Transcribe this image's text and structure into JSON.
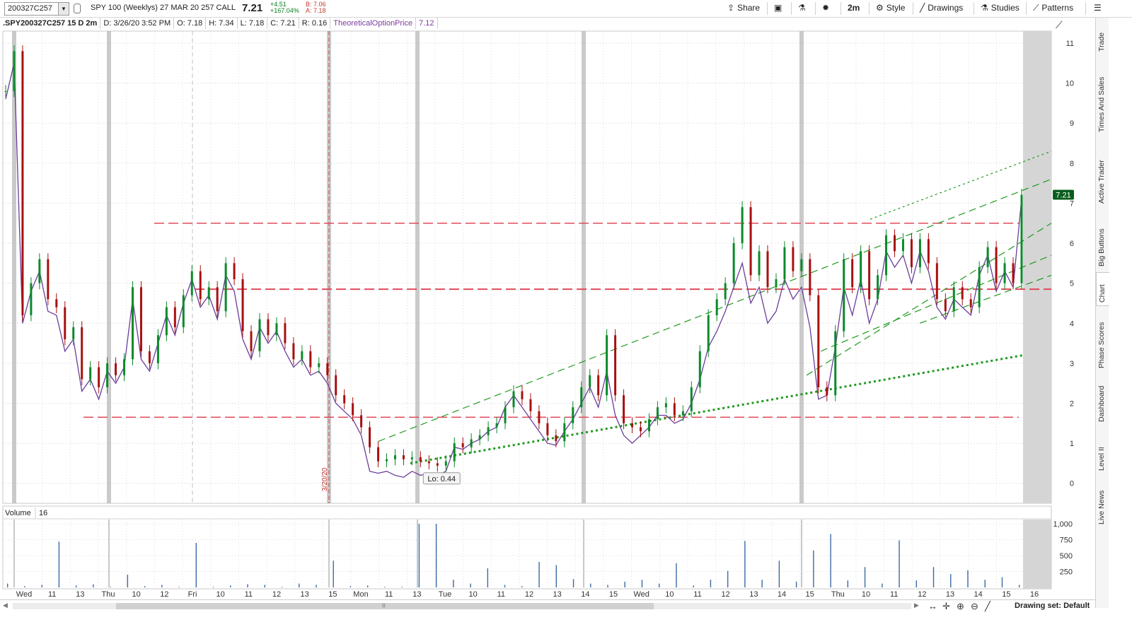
{
  "toolbar": {
    "symbol": "200327C257",
    "description": "SPY 100 (Weeklys) 27 MAR 20 257 CALL",
    "last": "7.21",
    "change": "+4.51",
    "change_pct": "+167.04%",
    "bid": "B: 7.06",
    "ask": "A: 7.18",
    "share": "Share",
    "interval": "2m",
    "style": "Style",
    "drawings": "Drawings",
    "studies": "Studies",
    "patterns": "Patterns"
  },
  "info": {
    "symbol": ".SPY200327C257 15 D 2m",
    "date": "D: 3/26/20 3:52 PM",
    "open": "O: 7.18",
    "high": "H: 7.34",
    "low": "L: 7.18",
    "close": "C: 7.21",
    "range": "R: 0.16",
    "study": "TheoreticalOptionPrice",
    "study_value": "7.12"
  },
  "price_badge": "7.21",
  "low_marker": "Lo: 0.44",
  "date_marker": "3/20/20",
  "volume_label": "Volume",
  "volume_value": "16",
  "right_nav": [
    "Trade",
    "Times And Sales",
    "Active Trader",
    "Big Buttons",
    "Chart",
    "Phase Scores",
    "Dashboard",
    "Level II",
    "Live News"
  ],
  "active_tab": "Chart",
  "drawing_set": "Drawing set: Default",
  "colors": {
    "up": "#0a8a2a",
    "down": "#a81010",
    "study": "#6a3d9a",
    "trend": "#1e9a1e",
    "hline": "#e04a5a"
  },
  "chart_data": {
    "type": "candlestick",
    "y_ticks": [
      "0",
      "1",
      "2",
      "3",
      "4",
      "5",
      "6",
      "7",
      "8",
      "9",
      "10",
      "11"
    ],
    "ylim": [
      -0.5,
      11.3
    ],
    "volume_ticks": [
      "250",
      "500",
      "750",
      "1,000"
    ],
    "volume_ylim": [
      0,
      1000
    ],
    "x_labels": [
      "Wed",
      "11",
      "13",
      "Thu",
      "10",
      "12",
      "Fri",
      "10",
      "11",
      "12",
      "13",
      "15",
      "Mon",
      "11",
      "13",
      "Tue",
      "10",
      "11",
      "12",
      "13",
      "14",
      "15",
      "Wed",
      "10",
      "11",
      "12",
      "13",
      "14",
      "15",
      "Thu",
      "10",
      "11",
      "12",
      "13",
      "14",
      "15",
      "16"
    ],
    "session_dividers": [
      3.0,
      5.0
    ],
    "horizontal_levels": [
      6.5,
      4.85,
      1.65
    ],
    "closes": [
      9.8,
      10.8,
      4.2,
      5.0,
      5.6,
      4.6,
      4.4,
      3.6,
      3.9,
      2.6,
      2.9,
      2.4,
      3.0,
      2.7,
      3.1,
      4.9,
      3.3,
      3.0,
      3.7,
      4.4,
      3.9,
      4.7,
      5.3,
      4.6,
      4.9,
      4.3,
      5.5,
      5.1,
      3.8,
      3.3,
      4.1,
      3.7,
      4.0,
      3.5,
      3.1,
      3.3,
      2.9,
      3.0,
      2.7,
      2.2,
      2.0,
      1.7,
      1.4,
      0.9,
      0.55,
      0.6,
      0.7,
      0.6,
      0.65,
      0.55,
      0.5,
      0.44,
      0.55,
      1.0,
      0.9,
      1.1,
      1.2,
      1.4,
      1.5,
      1.9,
      2.3,
      2.1,
      1.8,
      1.5,
      1.2,
      1.05,
      1.5,
      1.9,
      2.4,
      2.7,
      2.2,
      3.7,
      2.2,
      1.5,
      1.4,
      1.3,
      1.6,
      1.9,
      2.0,
      1.7,
      1.8,
      2.4,
      3.3,
      4.2,
      4.6,
      5.0,
      6.0,
      6.9,
      5.2,
      5.8,
      4.9,
      5.1,
      5.9,
      5.3,
      5.6,
      4.7,
      2.4,
      2.2,
      3.8,
      5.6,
      4.9,
      5.8,
      4.6,
      5.2,
      6.2,
      5.8,
      6.1,
      5.4,
      6.1,
      5.5,
      4.6,
      4.3,
      4.9,
      4.6,
      4.4,
      5.4,
      5.9,
      5.0,
      5.5,
      5.0,
      7.21
    ],
    "study_values": [
      9.6,
      10.5,
      4.0,
      4.8,
      5.3,
      4.3,
      4.2,
      3.3,
      3.6,
      2.3,
      2.6,
      2.1,
      2.8,
      2.5,
      2.9,
      4.6,
      3.1,
      2.8,
      3.5,
      4.2,
      3.7,
      4.5,
      5.1,
      4.4,
      4.7,
      4.1,
      5.2,
      4.8,
      3.6,
      3.1,
      3.9,
      3.5,
      3.8,
      3.3,
      2.9,
      3.1,
      2.7,
      2.8,
      2.5,
      2.0,
      1.8,
      1.6,
      1.2,
      0.3,
      0.25,
      0.3,
      0.2,
      0.15,
      0.3,
      0.2,
      0.25,
      0.2,
      0.3,
      0.9,
      0.85,
      1.0,
      1.1,
      1.3,
      1.4,
      1.9,
      2.2,
      1.9,
      1.6,
      1.3,
      1.0,
      0.95,
      1.3,
      1.6,
      2.0,
      2.4,
      1.9,
      2.8,
      1.7,
      1.2,
      1.0,
      1.2,
      1.4,
      1.7,
      1.7,
      1.5,
      1.6,
      2.0,
      2.6,
      3.4,
      3.8,
      4.3,
      4.9,
      5.5,
      4.5,
      4.9,
      4.0,
      4.3,
      5.1,
      4.6,
      4.9,
      3.9,
      2.1,
      2.2,
      3.4,
      4.9,
      4.2,
      5.1,
      4.0,
      4.6,
      5.8,
      5.4,
      5.7,
      5.0,
      5.8,
      5.3,
      4.4,
      4.1,
      4.6,
      4.4,
      4.2,
      5.2,
      5.7,
      4.8,
      5.3,
      4.9,
      7.12
    ],
    "volumes": [
      60,
      20,
      40,
      720,
      30,
      50,
      10,
      200,
      20,
      40,
      10,
      700,
      10,
      30,
      50,
      40,
      10,
      60,
      40,
      420,
      20,
      30,
      10,
      10,
      1000,
      1000,
      120,
      60,
      300,
      40,
      20,
      400,
      350,
      130,
      60,
      40,
      90,
      120,
      60,
      380,
      30,
      120,
      260,
      730,
      120,
      420,
      90,
      580,
      840,
      110,
      320,
      60,
      740,
      110,
      320,
      210,
      270,
      120,
      160,
      40
    ]
  }
}
